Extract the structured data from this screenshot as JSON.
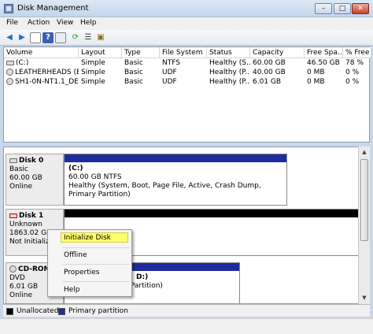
{
  "window": {
    "title": "Disk Management",
    "min_glyph": "–",
    "max_glyph": "□",
    "close_glyph": "✕"
  },
  "menu": [
    "File",
    "Action",
    "View",
    "Help"
  ],
  "toolbar_icons": [
    "back-icon",
    "forward-icon",
    "panel-icon",
    "help-icon",
    "panel2-icon",
    "refresh-icon",
    "properties-icon",
    "export-icon"
  ],
  "volumes": {
    "columns": [
      "Volume",
      "Layout",
      "Type",
      "File System",
      "Status",
      "Capacity",
      "Free Spa...",
      "% Free"
    ],
    "rows": [
      {
        "icon": "drive",
        "name": "(C:)",
        "layout": "Simple",
        "type": "Basic",
        "fs": "NTFS",
        "status": "Healthy (S...",
        "capacity": "60.00 GB",
        "free": "46.50 GB",
        "pct": "78 %"
      },
      {
        "icon": "cd",
        "name": "LEATHERHEADS (E:)",
        "layout": "Simple",
        "type": "Basic",
        "fs": "UDF",
        "status": "Healthy (P...",
        "capacity": "40.00 GB",
        "free": "0 MB",
        "pct": "0 %"
      },
      {
        "icon": "cd",
        "name": "SH1-0N-NT1.1_DE...",
        "layout": "Simple",
        "type": "Basic",
        "fs": "UDF",
        "status": "Healthy (P...",
        "capacity": "6.01 GB",
        "free": "0 MB",
        "pct": "0 %"
      }
    ]
  },
  "disks": [
    {
      "name": "Disk 0",
      "type": "Basic",
      "size": "60.00 GB",
      "state": "Online",
      "part_name": "(C:)",
      "part_size": "60.00 GB NTFS",
      "part_status": "Healthy (System, Boot, Page File, Active, Crash Dump, Primary Partition)"
    },
    {
      "name": "Disk 1",
      "type": "Unknown",
      "size": "1863.02 GB",
      "state": "Not Initializ"
    },
    {
      "name": "CD-ROM",
      "type": "DVD",
      "size": "6.01 GB",
      "state": "Online",
      "part_name": "D:)",
      "part_status": "Healthy (Primary Partition)"
    }
  ],
  "legend": [
    {
      "label": "Unallocated",
      "color": "#000000"
    },
    {
      "label": "Primary partition",
      "color": "#1f2d9c"
    }
  ],
  "context_menu": {
    "items": [
      "Initialize Disk",
      "Offline",
      "Properties",
      "Help"
    ],
    "highlight_color": "#ffff66"
  },
  "colors": {
    "primary": "#1f2d9c",
    "unallocated": "#000000"
  }
}
